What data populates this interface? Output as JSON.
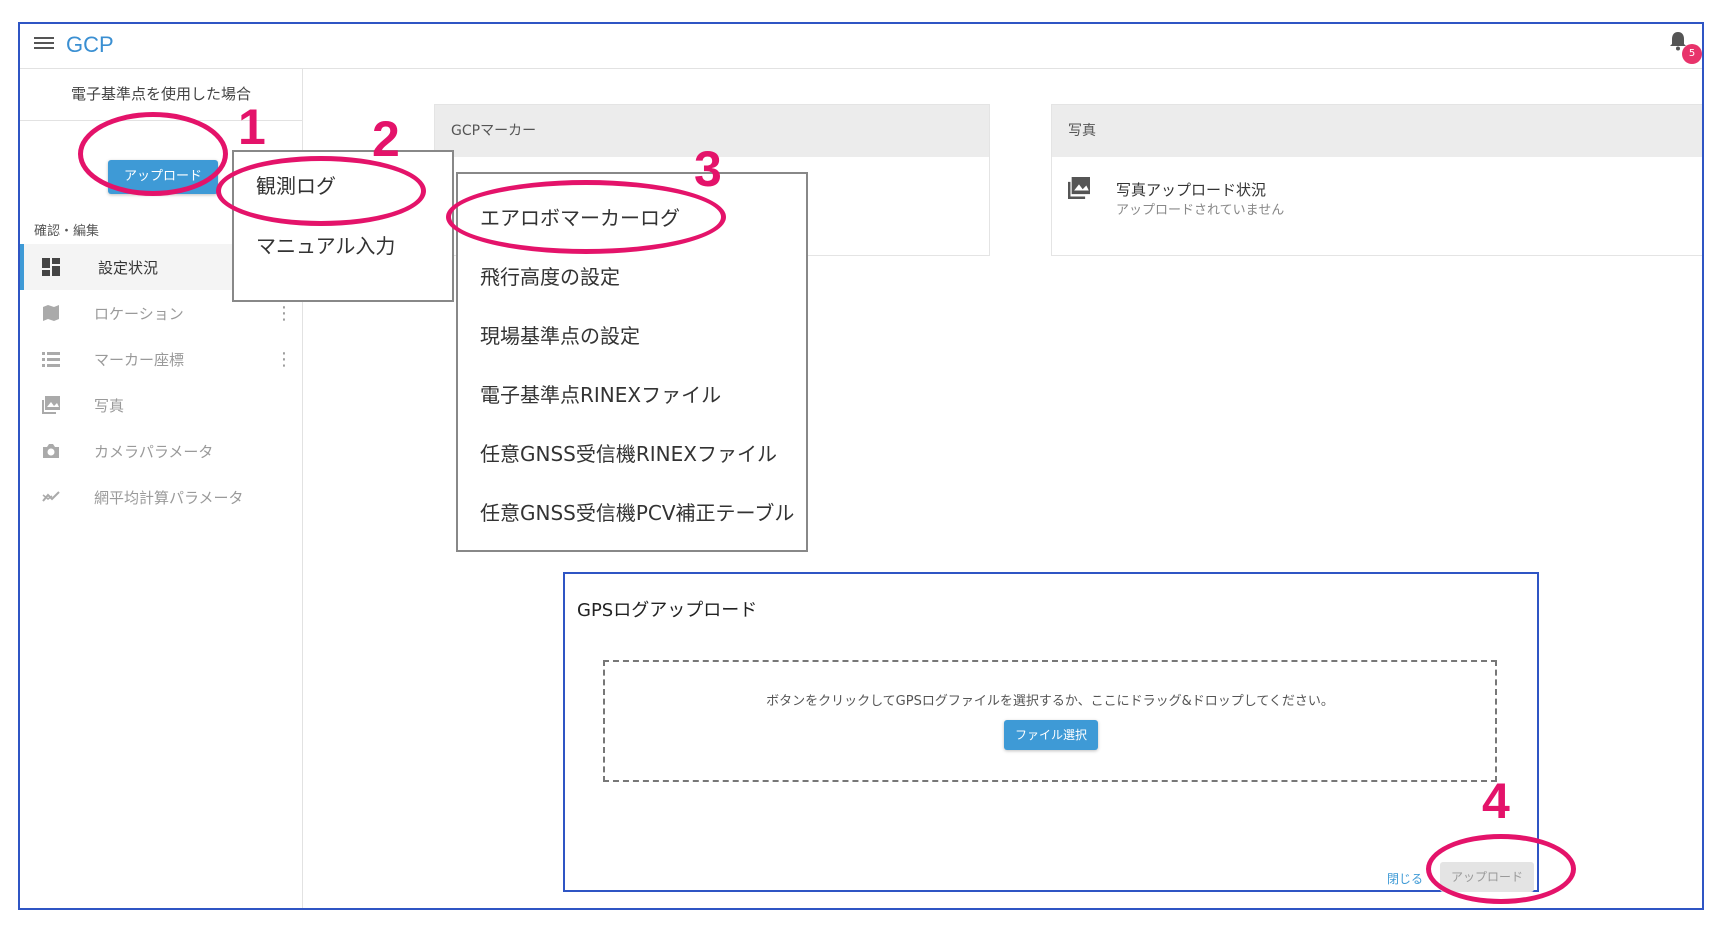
{
  "app": {
    "title": "GCP",
    "notification_count": "5"
  },
  "sidebar": {
    "header": "電子基準点を使用した場合",
    "upload_button": "アップロード",
    "section_label": "確認・編集",
    "items": [
      {
        "label": "設定状況",
        "icon": "dashboard-icon",
        "active": true
      },
      {
        "label": "ロケーション",
        "icon": "map-icon"
      },
      {
        "label": "マーカー座標",
        "icon": "list-icon"
      },
      {
        "label": "写真",
        "icon": "photo-icon"
      },
      {
        "label": "カメラパラメータ",
        "icon": "camera-icon"
      },
      {
        "label": "網平均計算パラメータ",
        "icon": "trend-icon"
      }
    ]
  },
  "cards": {
    "gcp_marker": {
      "title": "GCPマーカー"
    },
    "photo": {
      "title": "写真",
      "status_title": "写真アップロード状況",
      "status_sub": "アップロードされていません"
    }
  },
  "menu1": {
    "items": [
      "観測ログ",
      "マニュアル入力"
    ]
  },
  "menu2": {
    "items": [
      "エアロボマーカーログ",
      "飛行高度の設定",
      "現場基準点の設定",
      "電子基準点RINEXファイル",
      "任意GNSS受信機RINEXファイル",
      "任意GNSS受信機PCV補正テーブル"
    ]
  },
  "dialog": {
    "title": "GPSログアップロード",
    "drop_text": "ボタンをクリックしてGPSログファイルを選択するか、ここにドラッグ&ドロップしてください。",
    "file_button": "ファイル選択",
    "close_label": "閉じる",
    "upload_label": "アップロード"
  },
  "annotations": {
    "step1": "1",
    "step2": "2",
    "step3": "3",
    "step4": "4",
    "color": "#e4136a"
  },
  "colors": {
    "accent": "#3e9ad6",
    "frame": "#2f55c4"
  }
}
